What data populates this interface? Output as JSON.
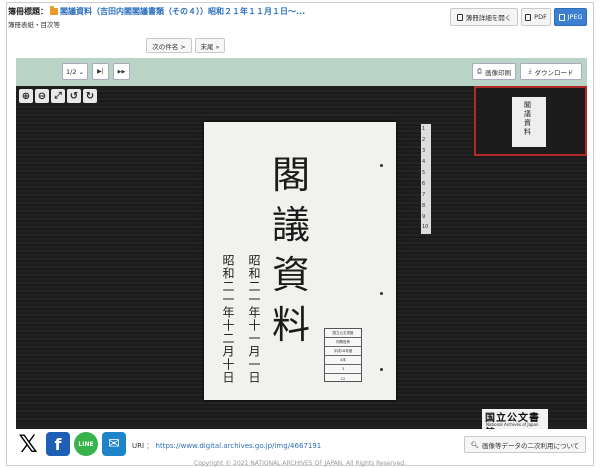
{
  "header": {
    "title_label": "簿冊標題：",
    "title_link": "閣議資料（吉田内閣閣議書類（その４））昭和２１年１１月１日～...",
    "subtitle": "簿冊表紙・目次等",
    "btn_detail": "簿冊詳細を開く",
    "btn_pdf": "PDF",
    "btn_jpeg": "JPEG",
    "next_item": "次の件名 >",
    "end": "末尾 »"
  },
  "toolbar": {
    "page_select": "1/2",
    "btn_first": "▶|",
    "btn_last": "▶▶",
    "print_label": "画像印刷",
    "download_label": "ダウンロード"
  },
  "viewer": {
    "zoom_icons": [
      "zoom-in-icon",
      "zoom-out-icon",
      "fullscreen-icon",
      "rotate-left-icon",
      "rotate-right-icon"
    ],
    "document": {
      "title_chars": [
        "閣",
        "議",
        "資",
        "料"
      ],
      "date_line_1": "昭和二一年十一月一日",
      "date_line_2": "昭和二一年十二月十日",
      "stamp": [
        "国立公文書館",
        "内閣官房",
        "平成16年度",
        "4本",
        "3",
        "12"
      ]
    },
    "ruler_numbers": [
      "1",
      "2",
      "3",
      "4",
      "5",
      "6",
      "7",
      "8",
      "9",
      "10"
    ],
    "thumb_chars": [
      "閣",
      "議",
      "資",
      "料"
    ],
    "logo_jp": "国立公文書館",
    "logo_en": "National Archives of Japan"
  },
  "footer": {
    "uri_label": "URI ：",
    "uri": "https://www.digital.archives.go.jp/img/4667191",
    "reuse_button": "画像等データの二次利用について",
    "share_x": "𝕏",
    "share_fb": "f",
    "share_line": "LINE",
    "share_mail": "✉",
    "copyright": "Copyright © 2021 NATIONAL ARCHIVES OF JAPAN. All Rights Reserved."
  },
  "colors": {
    "toolbar_bg": "#b9d4c7",
    "link": "#2a6ebb",
    "jpeg_active": "#3d7fd0"
  }
}
